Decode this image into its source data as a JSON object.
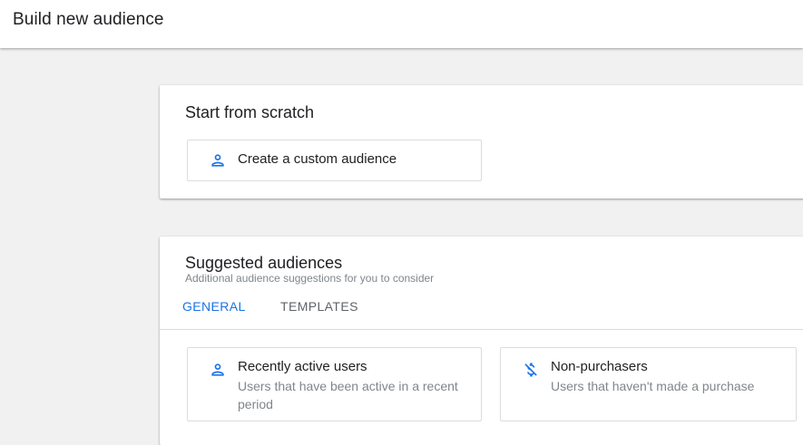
{
  "header": {
    "title": "Build new audience"
  },
  "scratch": {
    "title": "Start from scratch",
    "option": {
      "label": "Create a custom audience",
      "icon": "person-icon"
    }
  },
  "suggested": {
    "title": "Suggested audiences",
    "subtitle": "Additional audience suggestions for you to consider",
    "tabs": [
      {
        "label": "GENERAL",
        "active": true
      },
      {
        "label": "TEMPLATES",
        "active": false
      }
    ],
    "items": [
      {
        "title": "Recently active users",
        "description": "Users that have been active in a recent period",
        "icon": "person-icon"
      },
      {
        "title": "Non-purchasers",
        "description": "Users that haven't made a purchase",
        "icon": "no-money-icon"
      }
    ]
  },
  "colors": {
    "accent": "#1a73e8",
    "background": "#f1f1f1",
    "muted_text": "#80868b"
  }
}
